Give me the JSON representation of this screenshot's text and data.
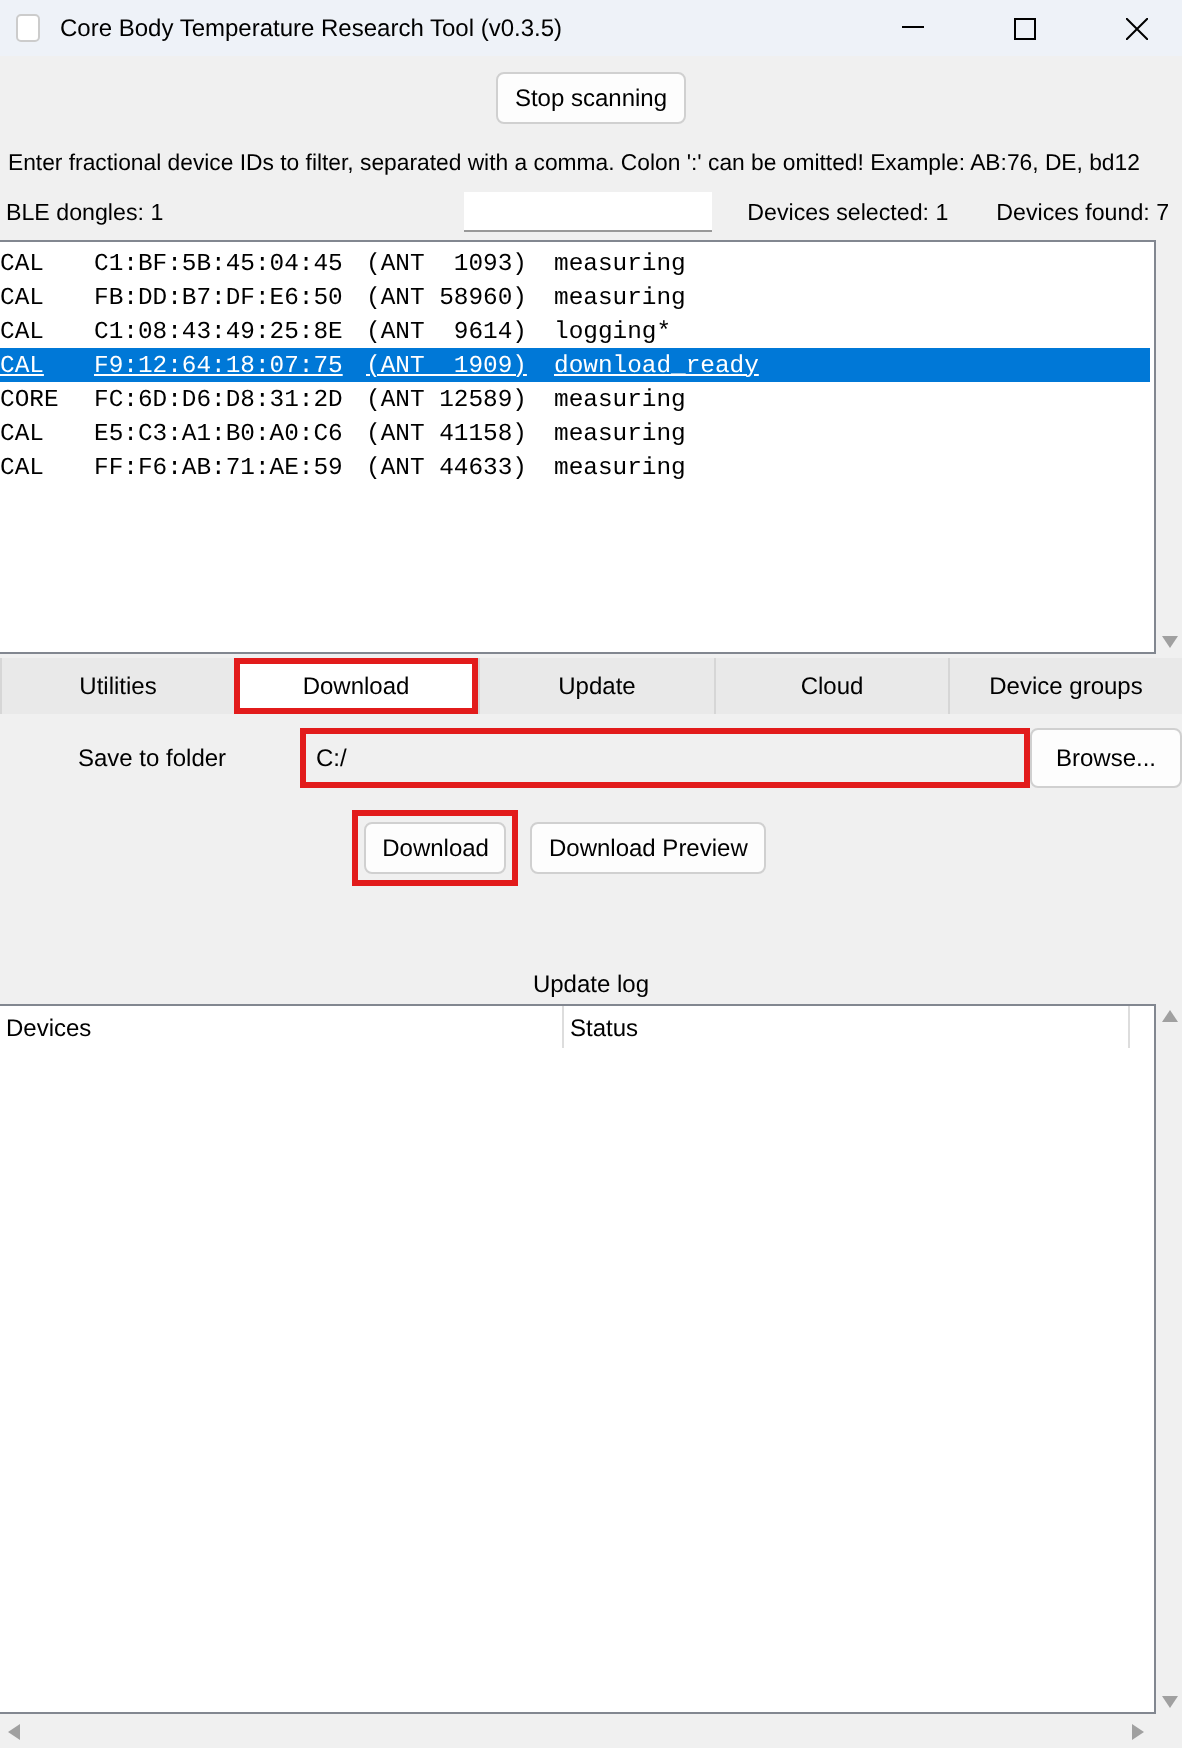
{
  "window": {
    "title": "Core Body Temperature Research Tool (v0.3.5)"
  },
  "scan_button": "Stop scanning",
  "filter_hint": "Enter fractional device IDs to filter, separated with a comma. Colon ':' can be omitted! Example: AB:76, DE, bd12",
  "status_row": {
    "dongles": "BLE dongles: 1",
    "selected_count": "Devices selected: 1",
    "found_count": "Devices found: 7"
  },
  "devices": [
    {
      "type": "CAL",
      "mac": "C1:BF:5B:45:04:45",
      "ant": "(ANT  1093)",
      "status": "measuring",
      "selected": false
    },
    {
      "type": "CAL",
      "mac": "FB:DD:B7:DF:E6:50",
      "ant": "(ANT 58960)",
      "status": "measuring",
      "selected": false
    },
    {
      "type": "CAL",
      "mac": "C1:08:43:49:25:8E",
      "ant": "(ANT  9614)",
      "status": "logging*",
      "selected": false
    },
    {
      "type": "CAL",
      "mac": "F9:12:64:18:07:75",
      "ant": "(ANT  1909)",
      "status": "download_ready",
      "selected": true
    },
    {
      "type": "CORE",
      "mac": "FC:6D:D6:D8:31:2D",
      "ant": "(ANT 12589)",
      "status": "measuring",
      "selected": false
    },
    {
      "type": "CAL",
      "mac": "E5:C3:A1:B0:A0:C6",
      "ant": "(ANT 41158)",
      "status": "measuring",
      "selected": false
    },
    {
      "type": "CAL",
      "mac": "FF:F6:AB:71:AE:59",
      "ant": "(ANT 44633)",
      "status": "measuring",
      "selected": false
    }
  ],
  "tabs": [
    {
      "label": "Utilities",
      "selected": false,
      "highlighted": false
    },
    {
      "label": "Download",
      "selected": true,
      "highlighted": true
    },
    {
      "label": "Update",
      "selected": false,
      "highlighted": false
    },
    {
      "label": "Cloud",
      "selected": false,
      "highlighted": false
    },
    {
      "label": "Device groups",
      "selected": false,
      "highlighted": false
    }
  ],
  "download": {
    "folder_label": "Save to folder",
    "folder_value": "C:/",
    "folder_highlighted": true,
    "browse": "Browse...",
    "buttons": [
      {
        "label": "Download",
        "highlighted": true
      },
      {
        "label": "Download Preview",
        "highlighted": false
      }
    ]
  },
  "update_log": {
    "title": "Update log",
    "columns": [
      "Devices",
      "Status"
    ]
  }
}
